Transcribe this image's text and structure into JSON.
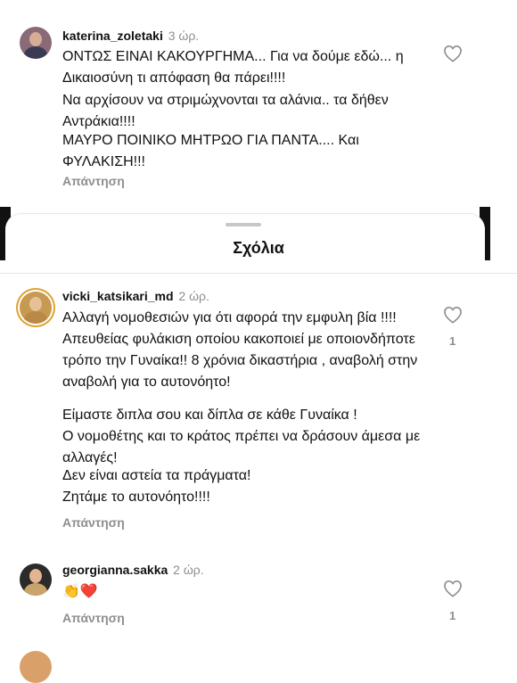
{
  "sheet": {
    "title": "Σχόλια"
  },
  "comments": [
    {
      "username": "katerina_zoletaki",
      "time": "3 ώρ.",
      "paragraphs": [
        "ΟΝΤΩΣ ΕΙΝΑΙ ΚΑΚΟΥΡΓΗΜΑ... Για να δούμε εδώ... η Δικαιοσύνη τι απόφαση θα πάρει!!!!",
        "Να αρχίσουν να στριμώχνονται τα αλάνια.. τα δήθεν Αντράκια!!!!",
        "ΜΑΥΡΟ ΠΟΙΝΙΚΟ ΜΗΤΡΩΟ ΓΙΑ ΠΑΝΤΑ.... Και ΦΥΛΑΚΙΣΗ!!!"
      ],
      "reply_label": "Απάντηση",
      "likes": ""
    },
    {
      "username": "vicki_katsikari_md",
      "time": "2 ώρ.",
      "paragraphs": [
        "Αλλαγή νομοθεσιών για ότι αφορά την εμφυλη βία !!!! Απευθείας φυλάκιση οποίου κακοποιεί με οποιονδήποτε τρόπο την Γυναίκα!! 8 χρόνια δικαστήρια , αναβολή στην αναβολή για το αυτονόητο!",
        "Είμαστε διπλα σου και δίπλα σε κάθε Γυναίκα !",
        "Ο νομοθέτης και το κράτος πρέπει να δράσουν άμεσα με αλλαγές!",
        "Δεν είναι αστεία τα πράγματα!",
        "Ζητάμε το αυτονόητο!!!!"
      ],
      "reply_label": "Απάντηση",
      "likes": "1"
    },
    {
      "username": "georgianna.sakka",
      "time": "2 ώρ.",
      "paragraphs": [
        "👏❤️"
      ],
      "reply_label": "Απάντηση",
      "likes": "1"
    }
  ],
  "icons": {
    "like": "heart-outline-icon"
  },
  "colors": {
    "muted": "#8e8e8e",
    "story_ring": "#e0a22f"
  }
}
